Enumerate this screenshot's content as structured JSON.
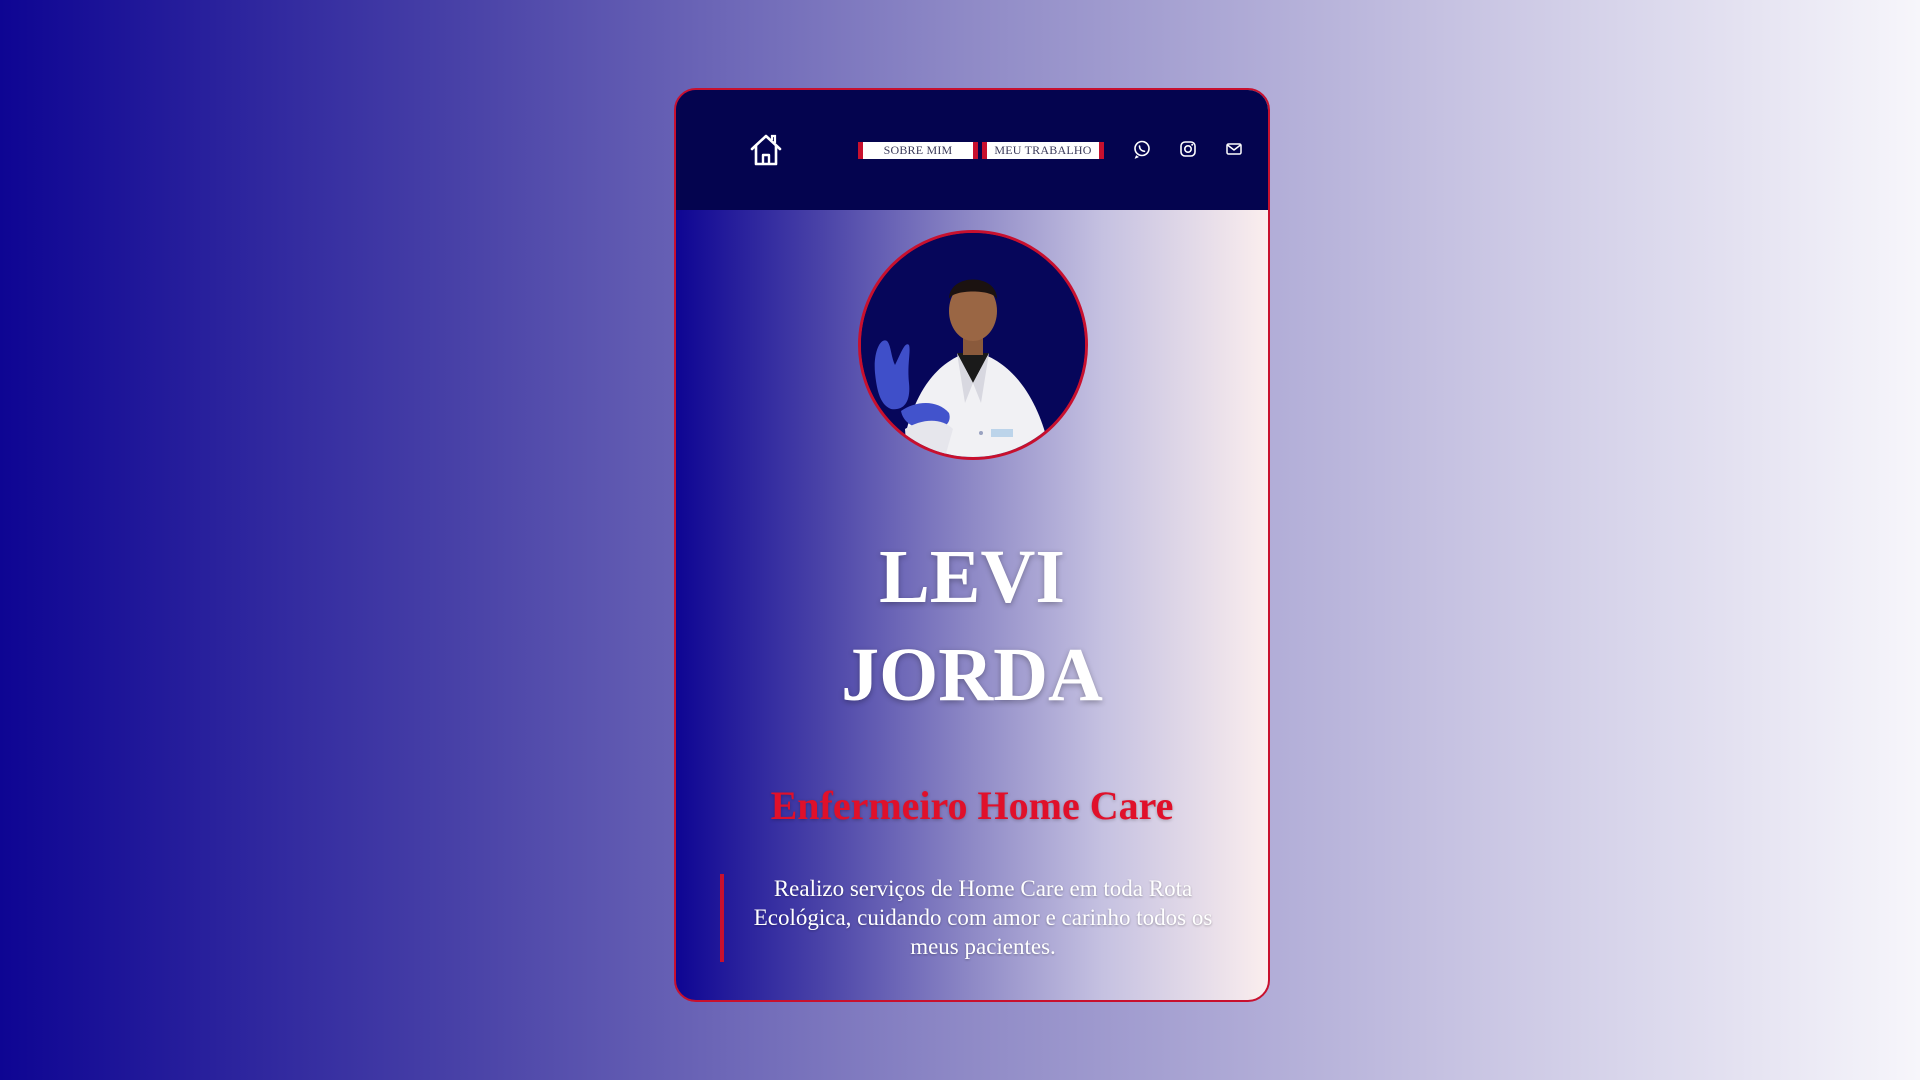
{
  "nav": {
    "home_icon": "home-icon",
    "links": [
      {
        "label": "SOBRE MIM"
      },
      {
        "label": "MEU TRABALHO"
      }
    ],
    "social_icons": [
      "whatsapp-icon",
      "instagram-icon",
      "email-icon"
    ]
  },
  "profile": {
    "name_line1": "LEVI",
    "name_line2": "JORDA",
    "role": "Enfermeiro Home Care",
    "description": "Realizo serviços de Home Care em toda Rota Ecológica, cuidando com amor e carinho todos os meus pacientes."
  },
  "colors": {
    "accent": "#c8102e",
    "navbar": "#04044f",
    "role_text": "#e0102a",
    "gradient_start": "#0e0593",
    "gradient_end": "#f7f6fb"
  }
}
